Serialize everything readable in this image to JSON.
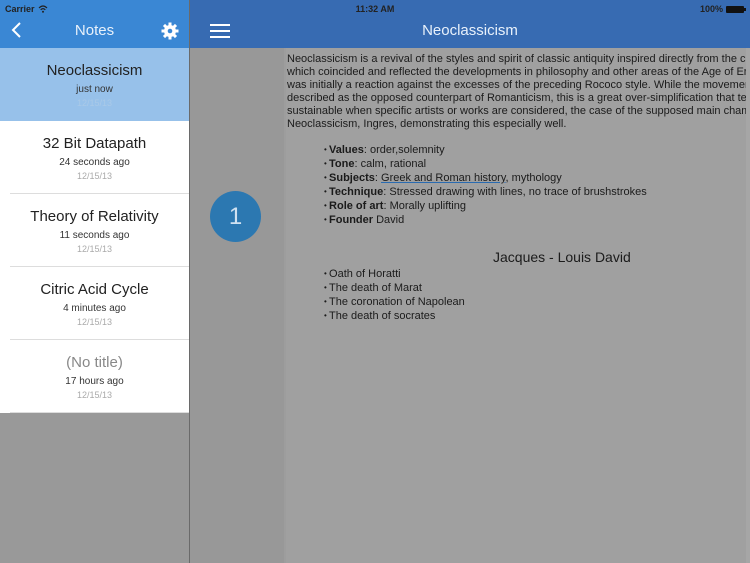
{
  "status_bar": {
    "carrier": "Carrier",
    "time": "11:32 AM",
    "battery": "100%"
  },
  "sidebar": {
    "title": "Notes",
    "back_icon": "chevron-left-icon",
    "settings_icon": "gear-icon",
    "notes": [
      {
        "title": "Neoclassicism",
        "relative": "just now",
        "date": "12/15/13",
        "selected": true
      },
      {
        "title": "32 Bit Datapath",
        "relative": "24 seconds ago",
        "date": "12/15/13"
      },
      {
        "title": "Theory of Relativity",
        "relative": "11 seconds ago",
        "date": "12/15/13"
      },
      {
        "title": "Citric Acid Cycle",
        "relative": "4 minutes ago",
        "date": "12/15/13"
      },
      {
        "title": "(No title)",
        "relative": "17 hours ago",
        "date": "12/15/13",
        "placeholder": true
      }
    ]
  },
  "main": {
    "title": "Neoclassicism",
    "menu_icon": "hamburger-menu-icon",
    "page_number": "1",
    "document": {
      "paragraph_lines": [
        "Neoclassicism is a revival of the styles and spirit of classic antiquity inspired directly from the cla",
        "which coincided and reflected the developments in philosophy and other areas of the Age of En",
        "was initially a reaction against the excesses of the preceding Rococo style. While the movemer",
        "described as the opposed counterpart of Romanticism, this is a great over-simplification that ter",
        "sustainable when specific artists or works are considered, the case of the supposed main cham",
        "Neoclassicism, Ingres, demonstrating this especially well."
      ],
      "attributes": [
        {
          "label": "Values",
          "sep": ": ",
          "value": "order,solemnity"
        },
        {
          "label": "Tone",
          "sep": ": ",
          "value": "calm, rational"
        },
        {
          "label": "Subjects",
          "sep": ": ",
          "link": "Greek and Roman history",
          "value": ", mythology"
        },
        {
          "label": "Technique",
          "sep": ": ",
          "value": "Stressed drawing with lines, no trace of brushstrokes"
        },
        {
          "label": "Role of art",
          "sep": ": ",
          "value": "Morally uplifting"
        },
        {
          "label": "Founder",
          "sep": " ",
          "value": "David"
        }
      ],
      "painter_heading": "Jacques - Louis David",
      "works": [
        "Oath of Horatti",
        "The death of Marat",
        "The coronation of Napolean",
        "The death of socrates"
      ]
    }
  }
}
